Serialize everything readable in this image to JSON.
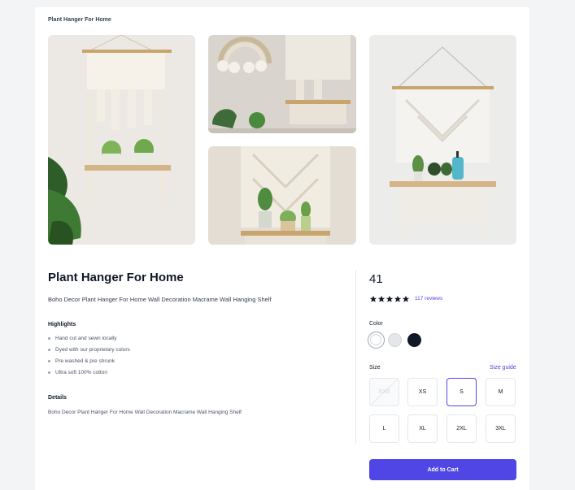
{
  "breadcrumb": "Plant Hanger For Home",
  "product": {
    "title": "Plant Hanger For Home",
    "description": "Boho Decor Plant Hanger For Home Wall Decoration Macrame Wall Hanging Shelf",
    "price": "41",
    "rating": 5,
    "reviews_label": "117 reviews"
  },
  "highlights": {
    "heading": "Highlights",
    "items": [
      "Hand cut and sewn locally",
      "Dyed with our proprietary colors",
      "Pre washed & pre shrunk",
      "Ultra soft 100% cotton"
    ]
  },
  "details": {
    "heading": "Details",
    "text": "Boho Decor Plant Hanger For Home Wall Decoration Macrame Wall Hanging Shelf"
  },
  "color": {
    "label": "Color",
    "options": [
      {
        "name": "white",
        "hex": "#ffffff",
        "selected": true
      },
      {
        "name": "gray",
        "hex": "#e5e7eb",
        "selected": false
      },
      {
        "name": "black",
        "hex": "#111827",
        "selected": false
      }
    ]
  },
  "size": {
    "label": "Size",
    "guide_label": "Size guide",
    "options": [
      {
        "label": "XXS",
        "state": "disabled"
      },
      {
        "label": "XS",
        "state": "available"
      },
      {
        "label": "S",
        "state": "selected"
      },
      {
        "label": "M",
        "state": "available"
      },
      {
        "label": "L",
        "state": "available"
      },
      {
        "label": "XL",
        "state": "available"
      },
      {
        "label": "2XL",
        "state": "available"
      },
      {
        "label": "3XL",
        "state": "available"
      }
    ]
  },
  "cart_button_label": "Add to Cart",
  "colors": {
    "accent": "#4f46e5",
    "star": "#111827"
  }
}
